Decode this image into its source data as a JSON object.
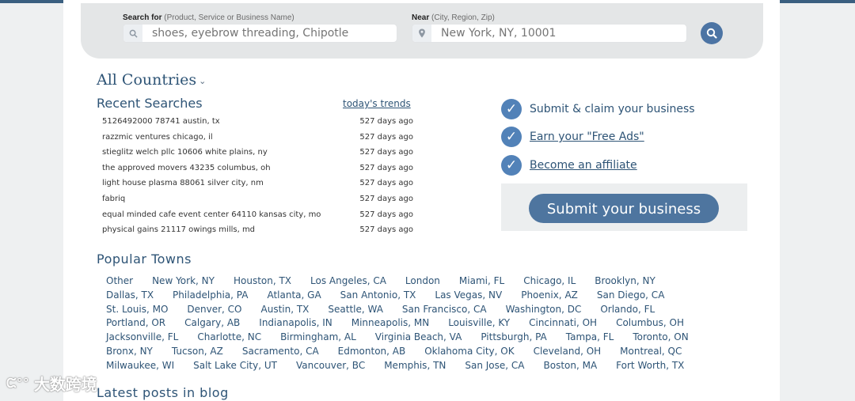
{
  "colors": {
    "accent": "#2e5476",
    "button": "#4e759f",
    "check": "#5282b8"
  },
  "search": {
    "what_label": "Search for",
    "what_hint": "(Product, Service or Business Name)",
    "what_placeholder": "shoes, eyebrow threading, Chipotle",
    "where_label": "Near",
    "where_hint": "(City, Region, Zip)",
    "where_placeholder": "New York, NY, 10001"
  },
  "countries": {
    "label": "All Countries"
  },
  "recent": {
    "title": "Recent Searches",
    "trends_link": "today's trends",
    "items": [
      {
        "query": "5126492000 78741 austin, tx",
        "age": "527 days ago"
      },
      {
        "query": "razzmic ventures chicago, il",
        "age": "527 days ago"
      },
      {
        "query": "stieglitz welch pllc 10606 white plains, ny",
        "age": "527 days ago"
      },
      {
        "query": "the approved movers 43235 columbus, oh",
        "age": "527 days ago"
      },
      {
        "query": "light house plasma 88061 silver city, nm",
        "age": "527 days ago"
      },
      {
        "query": "fabriq",
        "age": "527 days ago"
      },
      {
        "query": "equal minded cafe event center 64110 kansas city, mo",
        "age": "527 days ago"
      },
      {
        "query": "physical gains 21117 owings mills, md",
        "age": "527 days ago"
      }
    ]
  },
  "perks": [
    {
      "label": "Submit & claim your business"
    },
    {
      "label": "Earn your \"Free Ads\""
    },
    {
      "label": "Become an affiliate"
    }
  ],
  "submit": {
    "label": "Submit your business"
  },
  "popular": {
    "title": "Popular Towns",
    "rows": [
      [
        "Other",
        "New York, NY",
        "Houston, TX",
        "Los Angeles, CA",
        "London",
        "Miami, FL",
        "Chicago, IL",
        "Brooklyn, NY"
      ],
      [
        "Dallas, TX",
        "Philadelphia, PA",
        "Atlanta, GA",
        "San Antonio, TX",
        "Las Vegas, NV",
        "Phoenix, AZ",
        "San Diego, CA"
      ],
      [
        "St. Louis, MO",
        "Denver, CO",
        "Austin, TX",
        "Seattle, WA",
        "San Francisco, CA",
        "Washington, DC",
        "Orlando, FL"
      ],
      [
        "Portland, OR",
        "Calgary, AB",
        "Indianapolis, IN",
        "Minneapolis, MN",
        "Louisville, KY",
        "Cincinnati, OH",
        "Columbus, OH"
      ],
      [
        "Jacksonville, FL",
        "Charlotte, NC",
        "Birmingham, AL",
        "Virginia Beach, VA",
        "Pittsburgh, PA",
        "Tampa, FL",
        "Toronto, ON"
      ],
      [
        "Bronx, NY",
        "Tucson, AZ",
        "Sacramento, CA",
        "Edmonton, AB",
        "Oklahoma City, OK",
        "Cleveland, OH",
        "Montreal, QC"
      ],
      [
        "Milwaukee, WI",
        "Salt Lake City, UT",
        "Vancouver, BC",
        "Memphis, TN",
        "San Jose, CA",
        "Boston, MA",
        "Fort Worth, TX"
      ]
    ]
  },
  "blog": {
    "title": "Latest posts in blog"
  },
  "watermark": {
    "text": "大数跨境"
  }
}
